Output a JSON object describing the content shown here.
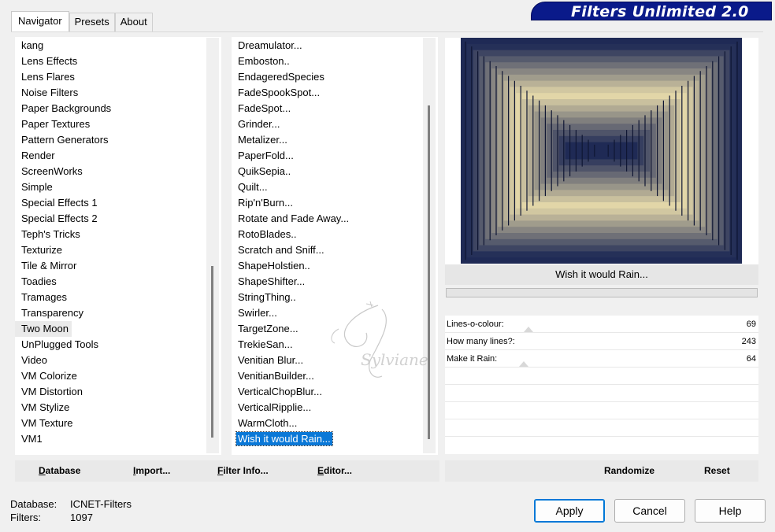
{
  "banner": {
    "title": "Filters Unlimited 2.0"
  },
  "tabs": [
    {
      "label": "Navigator"
    },
    {
      "label": "Presets"
    },
    {
      "label": "About"
    }
  ],
  "categories": {
    "items": [
      "kang",
      "Lens Effects",
      "Lens Flares",
      "Noise Filters",
      "Paper Backgrounds",
      "Paper Textures",
      "Pattern Generators",
      "Render",
      "ScreenWorks",
      "Simple",
      "Special Effects 1",
      "Special Effects 2",
      "Teph's Tricks",
      "Texturize",
      "Tile & Mirror",
      "Toadies",
      "Tramages",
      "Transparency",
      "Two Moon",
      "UnPlugged Tools",
      "Video",
      "VM Colorize",
      "VM Distortion",
      "VM Stylize",
      "VM Texture",
      "VM1"
    ],
    "selected": "Two Moon"
  },
  "filters": {
    "items": [
      "Dreamulator...",
      "Emboston..",
      "EndageredSpecies",
      "FadeSpookSpot...",
      "FadeSpot...",
      "Grinder...",
      "Metalizer...",
      "PaperFold...",
      "QuikSepia..",
      "Quilt...",
      "Rip'n'Burn...",
      "Rotate and Fade Away...",
      "RotoBlades..",
      "Scratch and Sniff...",
      "ShapeHolstien..",
      "ShapeShifter...",
      "StringThing..",
      "Swirler...",
      "TargetZone...",
      "TrekieSan...",
      "Venitian Blur...",
      "VenitianBuilder...",
      "VerticalChopBlur...",
      "VerticalRipplie...",
      "WarmCloth...",
      "Wish it would Rain..."
    ],
    "selected": "Wish it would Rain..."
  },
  "preview": {
    "filter_name": "Wish it would Rain...",
    "colors": {
      "dark": "#1f2a55",
      "light": "#e6d9aa"
    }
  },
  "params": [
    {
      "label": "Lines-o-colour:",
      "value": "69"
    },
    {
      "label": "How many lines?:",
      "value": "243"
    },
    {
      "label": "Make it Rain:",
      "value": "64"
    }
  ],
  "left_buttons": {
    "database": "Database",
    "import": "Import...",
    "filter_info": "Filter Info...",
    "editor": "Editor..."
  },
  "right_buttons": {
    "randomize": "Randomize",
    "reset": "Reset"
  },
  "info": {
    "database_label": "Database:",
    "database_value": "ICNET-Filters",
    "filters_label": "Filters:",
    "filters_value": "1097"
  },
  "dialog": {
    "apply": "Apply",
    "cancel": "Cancel",
    "help": "Help"
  },
  "watermark": {
    "text": "Sylviane"
  }
}
